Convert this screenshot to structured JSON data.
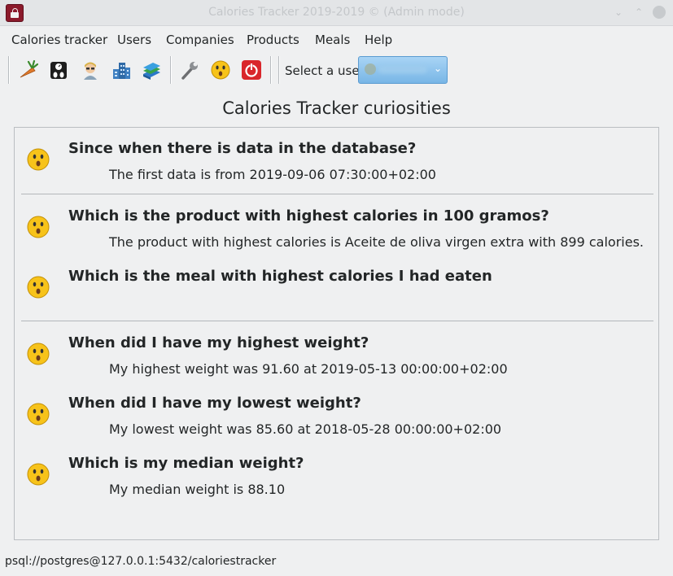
{
  "window": {
    "title": "Calories Tracker 2019-2019 © (Admin mode)"
  },
  "menu": [
    "Calories tracker",
    "Users",
    "Companies",
    "Products",
    "Meals",
    "Help"
  ],
  "toolbar": {
    "icons": [
      "carrot-food-icon",
      "weight-scale-icon",
      "user-portrait-icon",
      "company-building-icon",
      "books-icon",
      "wrench-icon",
      "surprised-face-icon",
      "power-exit-icon"
    ],
    "select_user_label": "Select a user",
    "selected_user": ""
  },
  "page_title": "Calories Tracker curiosities",
  "curiosities": [
    {
      "question": "Since when there is data in the database?",
      "answer": "The first data is from 2019-09-06 07:30:00+02:00"
    },
    {
      "question": "Which is the product with highest calories in 100 gramos?",
      "answer": "The product with highest calories is Aceite de oliva virgen extra with 899 calories."
    },
    {
      "question": "Which is the meal with highest calories I had eaten",
      "answer": ""
    },
    {
      "question": "When did I have my highest weight?",
      "answer": "My highest weight was 91.60 at 2019-05-13 00:00:00+02:00"
    },
    {
      "question": "When did I have my lowest weight?",
      "answer": "My lowest weight was 85.60 at 2018-05-28 00:00:00+02:00"
    },
    {
      "question": "Which is my median weight?",
      "answer": "My median weight is 88.10"
    }
  ],
  "status": "psql://postgres@127.0.0.1:5432/caloriestracker",
  "colors": {
    "window_bg": "#eff0f1",
    "accent": "#78b6e6",
    "emoji_face": "#f7c31a"
  }
}
